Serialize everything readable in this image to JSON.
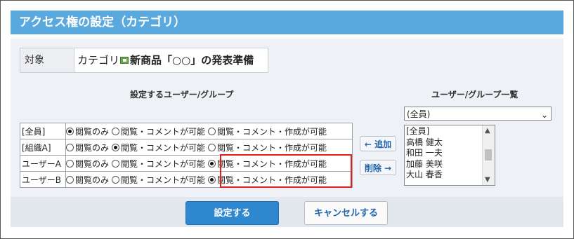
{
  "title": "アクセス権の設定（カテゴリ）",
  "target": {
    "label": "対象",
    "category_prefix": "カテゴリ",
    "category_name": "新商品「○○」の発表準備"
  },
  "headers": {
    "set": "設定するユーザー/グループ",
    "list": "ユーザー/グループ一覧"
  },
  "options": [
    "閲覧のみ",
    "閲覧・コメントが可能",
    "閲覧・コメント・作成が可能"
  ],
  "rows": [
    {
      "name": "[全員]",
      "selected": 0
    },
    {
      "name": "[組織A]",
      "selected": 1
    },
    {
      "name": "ユーザーA",
      "selected": 2
    },
    {
      "name": "ユーザーB",
      "selected": 2
    }
  ],
  "buttons": {
    "add": "← 追加",
    "remove": "削除 →",
    "submit": "設定する",
    "cancel": "キャンセルする"
  },
  "group_select": {
    "value": "(全員)"
  },
  "user_list": [
    "[全員]",
    "高橋 健太",
    "和田 一夫",
    "加藤 美咲",
    "大山 春香"
  ],
  "colors": {
    "header": "#5aa9de",
    "primary_button": "#2f87d0",
    "highlight": "#e0201a"
  }
}
